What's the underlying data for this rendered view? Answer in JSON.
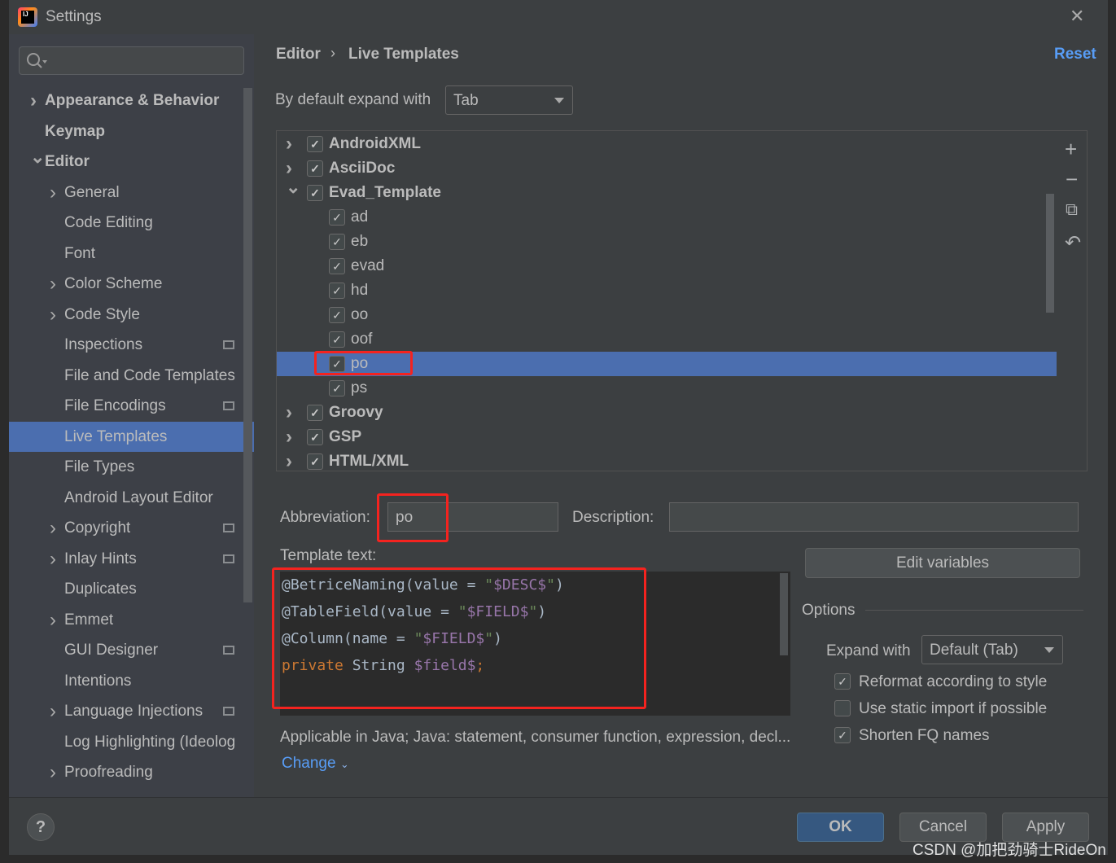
{
  "window": {
    "title": "Settings",
    "close": "✕"
  },
  "sidebar": {
    "items": [
      {
        "label": "Appearance & Behavior",
        "level": 0,
        "chevron": "right",
        "bold": true
      },
      {
        "label": "Keymap",
        "level": 0,
        "chevron": "",
        "bold": true
      },
      {
        "label": "Editor",
        "level": 0,
        "chevron": "down",
        "bold": true
      },
      {
        "label": "General",
        "level": 1,
        "chevron": "right"
      },
      {
        "label": "Code Editing",
        "level": 1,
        "chevron": ""
      },
      {
        "label": "Font",
        "level": 1,
        "chevron": ""
      },
      {
        "label": "Color Scheme",
        "level": 1,
        "chevron": "right"
      },
      {
        "label": "Code Style",
        "level": 1,
        "chevron": "right"
      },
      {
        "label": "Inspections",
        "level": 1,
        "chevron": "",
        "project": true
      },
      {
        "label": "File and Code Templates",
        "level": 1,
        "chevron": ""
      },
      {
        "label": "File Encodings",
        "level": 1,
        "chevron": "",
        "project": true
      },
      {
        "label": "Live Templates",
        "level": 1,
        "chevron": "",
        "selected": true
      },
      {
        "label": "File Types",
        "level": 1,
        "chevron": ""
      },
      {
        "label": "Android Layout Editor",
        "level": 1,
        "chevron": ""
      },
      {
        "label": "Copyright",
        "level": 1,
        "chevron": "right",
        "project": true
      },
      {
        "label": "Inlay Hints",
        "level": 1,
        "chevron": "right",
        "project": true
      },
      {
        "label": "Duplicates",
        "level": 1,
        "chevron": ""
      },
      {
        "label": "Emmet",
        "level": 1,
        "chevron": "right"
      },
      {
        "label": "GUI Designer",
        "level": 1,
        "chevron": "",
        "project": true
      },
      {
        "label": "Intentions",
        "level": 1,
        "chevron": ""
      },
      {
        "label": "Language Injections",
        "level": 1,
        "chevron": "right",
        "project": true
      },
      {
        "label": "Log Highlighting (Ideolog)",
        "level": 1,
        "chevron": ""
      },
      {
        "label": "Proofreading",
        "level": 1,
        "chevron": "right"
      }
    ]
  },
  "breadcrumb": {
    "parent": "Editor",
    "current": "Live Templates",
    "reset": "Reset"
  },
  "expand_default": {
    "label": "By default expand with",
    "value": "Tab"
  },
  "tree": {
    "rows": [
      {
        "label": "AndroidXML",
        "level": 0,
        "chevron": "right",
        "checked": true
      },
      {
        "label": "AsciiDoc",
        "level": 0,
        "chevron": "right",
        "checked": true
      },
      {
        "label": "Evad_Template",
        "level": 0,
        "chevron": "down",
        "checked": true
      },
      {
        "label": "ad",
        "level": 1,
        "checked": true
      },
      {
        "label": "eb",
        "level": 1,
        "checked": true
      },
      {
        "label": "evad",
        "level": 1,
        "checked": true
      },
      {
        "label": "hd",
        "level": 1,
        "checked": true
      },
      {
        "label": "oo",
        "level": 1,
        "checked": true
      },
      {
        "label": "oof",
        "level": 1,
        "checked": true
      },
      {
        "label": "po",
        "level": 1,
        "checked": true,
        "selected": true
      },
      {
        "label": "ps",
        "level": 1,
        "checked": true
      },
      {
        "label": "Groovy",
        "level": 0,
        "chevron": "right",
        "checked": true
      },
      {
        "label": "GSP",
        "level": 0,
        "chevron": "right",
        "checked": true
      },
      {
        "label": "HTML/XML",
        "level": 0,
        "chevron": "right",
        "checked": true
      }
    ]
  },
  "toolbar": {
    "add": "+",
    "remove": "−",
    "copy": "⧉",
    "restore": "↶"
  },
  "abbreviation": {
    "label": "Abbreviation:",
    "value": "po"
  },
  "description": {
    "label": "Description:",
    "value": ""
  },
  "template_text": {
    "label": "Template text:",
    "lines": [
      [
        {
          "t": "@BetriceNaming(value = ",
          "c": "#a9b7c6"
        },
        {
          "t": "\"",
          "c": "#6a8759"
        },
        {
          "t": "$DESC$",
          "c": "#9876aa"
        },
        {
          "t": "\"",
          "c": "#6a8759"
        },
        {
          "t": ")",
          "c": "#a9b7c6"
        }
      ],
      [
        {
          "t": "@TableField(value = ",
          "c": "#a9b7c6"
        },
        {
          "t": "\"",
          "c": "#6a8759"
        },
        {
          "t": "$FIELD$",
          "c": "#9876aa"
        },
        {
          "t": "\"",
          "c": "#6a8759"
        },
        {
          "t": ")",
          "c": "#a9b7c6"
        }
      ],
      [
        {
          "t": "@Column(name = ",
          "c": "#a9b7c6"
        },
        {
          "t": "\"",
          "c": "#6a8759"
        },
        {
          "t": "$FIELD$",
          "c": "#9876aa"
        },
        {
          "t": "\"",
          "c": "#6a8759"
        },
        {
          "t": ")",
          "c": "#a9b7c6"
        }
      ],
      [
        {
          "t": "private ",
          "c": "#cc7832"
        },
        {
          "t": "String ",
          "c": "#a9b7c6"
        },
        {
          "t": "$field$",
          "c": "#9876aa"
        },
        {
          "t": ";",
          "c": "#cc7832"
        }
      ]
    ]
  },
  "edit_variables": "Edit variables",
  "applicable": {
    "text": "Applicable in Java; Java: statement, consumer function, expression, decl...",
    "change": "Change"
  },
  "options": {
    "title": "Options",
    "expand_label": "Expand with",
    "expand_value": "Default (Tab)",
    "checks": [
      {
        "label": "Reformat according to style",
        "checked": true
      },
      {
        "label": "Use static import if possible",
        "checked": false
      },
      {
        "label": "Shorten FQ names",
        "checked": true
      }
    ]
  },
  "footer": {
    "help": "?",
    "ok": "OK",
    "cancel": "Cancel",
    "apply": "Apply"
  },
  "watermark": "CSDN @加把劲骑士RideOn",
  "colors": {
    "selection": "#4b6eaf",
    "accent_link": "#589df6",
    "highlight_box": "#f4231f"
  }
}
